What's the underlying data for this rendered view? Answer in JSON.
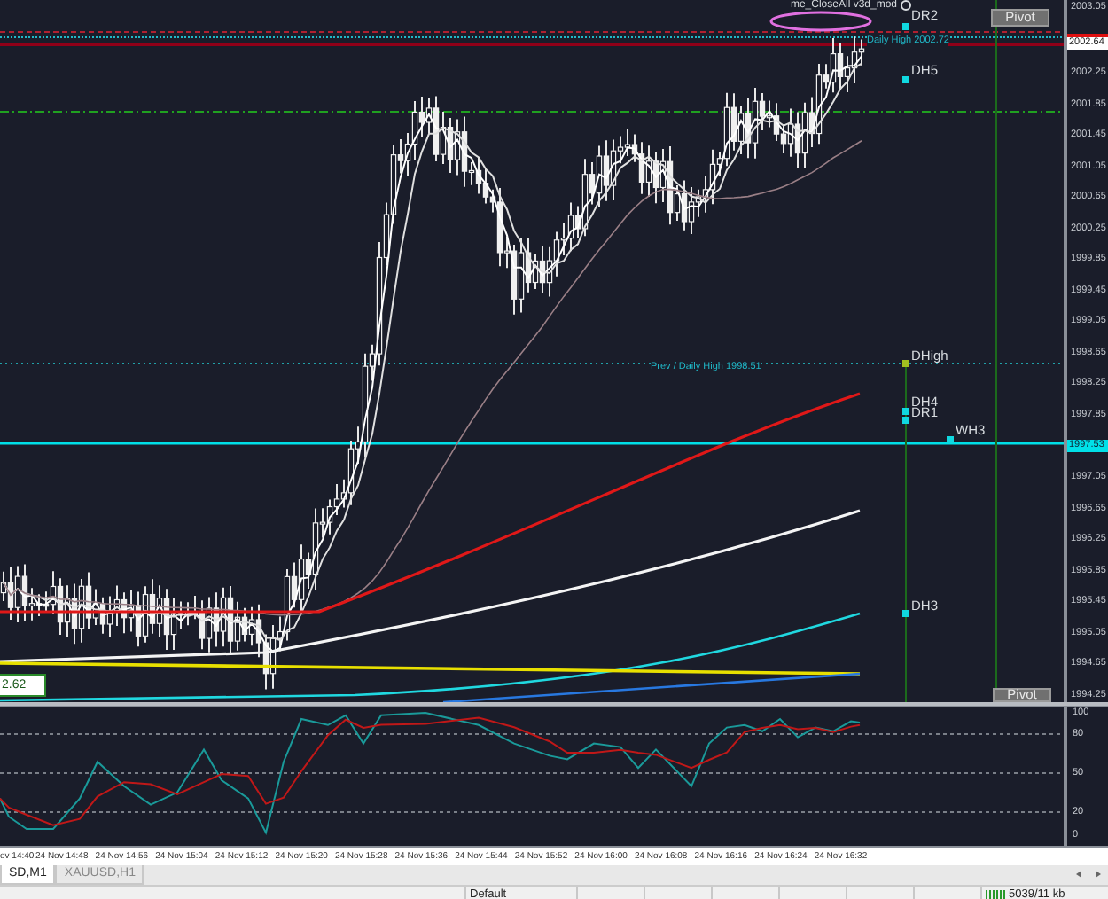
{
  "chart": {
    "expert": {
      "name": "me_CloseAll v3d_mod",
      "active": true
    },
    "buttons": [
      {
        "label": "Pivot"
      },
      {
        "label": "Pivot"
      }
    ],
    "price_axis": [
      {
        "text": "2003.05",
        "kind": "tick"
      },
      {
        "text": "2002.64",
        "kind": "bid"
      },
      {
        "text": "2002.25",
        "kind": "tick"
      },
      {
        "text": "2001.85",
        "kind": "tick"
      },
      {
        "text": "2001.45",
        "kind": "tick"
      },
      {
        "text": "2001.05",
        "kind": "tick"
      },
      {
        "text": "2000.65",
        "kind": "tick"
      },
      {
        "text": "2000.25",
        "kind": "tick"
      },
      {
        "text": "1999.85",
        "kind": "tick"
      },
      {
        "text": "1999.45",
        "kind": "tick"
      },
      {
        "text": "1999.05",
        "kind": "tick"
      },
      {
        "text": "1998.65",
        "kind": "tick"
      },
      {
        "text": "1998.25",
        "kind": "tick"
      },
      {
        "text": "1997.85",
        "kind": "tick"
      },
      {
        "text": "1997.53",
        "kind": "level"
      },
      {
        "text": "1997.05",
        "kind": "tick"
      },
      {
        "text": "1996.65",
        "kind": "tick"
      },
      {
        "text": "1996.25",
        "kind": "tick"
      },
      {
        "text": "1995.85",
        "kind": "tick"
      },
      {
        "text": "1995.45",
        "kind": "tick"
      },
      {
        "text": "1995.05",
        "kind": "tick"
      },
      {
        "text": "1994.65",
        "kind": "tick"
      },
      {
        "text": "1994.25",
        "kind": "tick"
      }
    ],
    "labels": [
      {
        "text": "DR2",
        "kind": "marker"
      },
      {
        "text": "Daily High 2002.72",
        "kind": "line"
      },
      {
        "text": "DH5",
        "kind": "marker"
      },
      {
        "text": "DHigh",
        "kind": "marker"
      },
      {
        "text": "Prev / Daily High 1998.51",
        "kind": "line"
      },
      {
        "text": "DH4",
        "kind": "marker"
      },
      {
        "text": "DR1",
        "kind": "marker"
      },
      {
        "text": "WH3",
        "kind": "marker"
      },
      {
        "text": "DH3",
        "kind": "marker"
      }
    ],
    "value_box": "2.62"
  },
  "oscillator": {
    "levels": [
      "100",
      "80",
      "50",
      "20",
      "0"
    ]
  },
  "time_axis": [
    "ov 14:40",
    "24 Nov 14:48",
    "24 Nov 14:56",
    "24 Nov 15:04",
    "24 Nov 15:12",
    "24 Nov 15:20",
    "24 Nov 15:28",
    "24 Nov 15:36",
    "24 Nov 15:44",
    "24 Nov 15:52",
    "24 Nov 16:00",
    "24 Nov 16:08",
    "24 Nov 16:16",
    "24 Nov 16:24",
    "24 Nov 16:32"
  ],
  "tabs": [
    {
      "label": "SD,M1",
      "selected": true
    },
    {
      "label": "XAUUSD,H1",
      "selected": false
    }
  ],
  "status_bar": {
    "profile": "Default",
    "traffic": "5039/11 kb"
  }
}
